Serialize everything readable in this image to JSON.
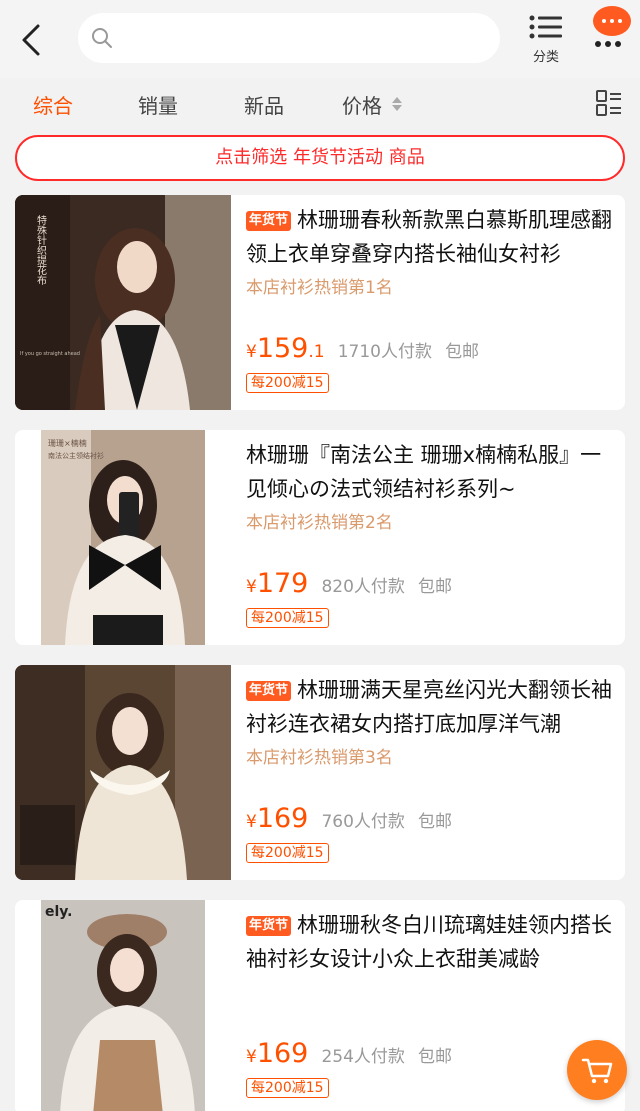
{
  "header": {
    "search_value": "",
    "category_label": "分类",
    "icons": [
      "back-icon",
      "search-icon",
      "list-icon",
      "more-icon"
    ]
  },
  "tabs": [
    {
      "label": "综合",
      "active": true
    },
    {
      "label": "销量"
    },
    {
      "label": "新品"
    },
    {
      "label": "价格"
    }
  ],
  "filter_banner": "点击筛选 年货节活动 商品",
  "products": [
    {
      "tag": "年货节",
      "title": "林珊珊春秋新款黑白慕斯肌理感翻领上衣单穿叠穿内搭长袖仙女衬衫",
      "rank": "本店衬衫热销第1名",
      "currency": "¥",
      "price": "159",
      "price_cents": ".1",
      "sold": "1710人付款",
      "shipping": "包邮",
      "promo": "每200减15",
      "image_text": [
        "特殊针织提花布",
        "If you go straight ahead"
      ]
    },
    {
      "tag": "",
      "title": "林珊珊『南法公主 珊珊x楠楠私服』一见倾心の法式领结衬衫系列~",
      "rank": "本店衬衫热销第2名",
      "currency": "¥",
      "price": "179",
      "price_cents": "",
      "sold": "820人付款",
      "shipping": "包邮",
      "promo": "每200减15",
      "image_text": [
        "珊珊×楠楠",
        "南法公主领结衬衫"
      ]
    },
    {
      "tag": "年货节",
      "title": "林珊珊满天星亮丝闪光大翻领长袖衬衫连衣裙女内搭打底加厚洋气潮",
      "rank": "本店衬衫热销第3名",
      "currency": "¥",
      "price": "169",
      "price_cents": "",
      "sold": "760人付款",
      "shipping": "包邮",
      "promo": "每200减15",
      "image_text": []
    },
    {
      "tag": "年货节",
      "title": "林珊珊秋冬白川琉璃娃娃领内搭长袖衬衫女设计小众上衣甜美减龄",
      "rank": "",
      "currency": "¥",
      "price": "169",
      "price_cents": "",
      "sold": "254人付款",
      "shipping": "包邮",
      "promo": "每200减15",
      "image_text": [
        "ely."
      ]
    }
  ],
  "colors": {
    "accent": "#ff5000",
    "banner_red": "#ff2a2a",
    "rank": "#d99a6c",
    "fab": "#ff7e1f"
  }
}
